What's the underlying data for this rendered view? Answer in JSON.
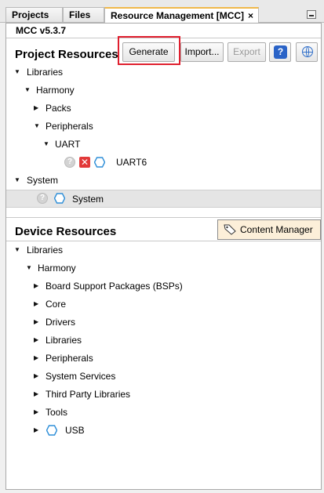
{
  "tabs": [
    {
      "label": "Projects",
      "active": false
    },
    {
      "label": "Files",
      "active": false
    },
    {
      "label": "Resource Management [MCC]",
      "active": true,
      "close": "×"
    }
  ],
  "version": "MCC v5.3.7",
  "project_resources": {
    "title": "Project Resources",
    "buttons": {
      "generate": "Generate",
      "import": "Import...",
      "export": "Export",
      "help": "?"
    },
    "tree": {
      "libraries": "Libraries",
      "harmony": "Harmony",
      "packs": "Packs",
      "peripherals": "Peripherals",
      "uart": "UART",
      "uart6": "UART6",
      "system_group": "System",
      "system_item": "System"
    }
  },
  "device_resources": {
    "title": "Device Resources",
    "content_manager": "Content Manager",
    "tree": {
      "libraries": "Libraries",
      "harmony": "Harmony",
      "items": [
        "Board Support Packages (BSPs)",
        "Core",
        "Drivers",
        "Libraries",
        "Peripherals",
        "System Services",
        "Third Party Libraries",
        "Tools",
        "USB"
      ]
    }
  },
  "colors": {
    "accent_tab": "#f0b84a",
    "highlight": "#e01f2e",
    "hex_icon": "#2f8fd8",
    "error": "#e23a3a"
  }
}
